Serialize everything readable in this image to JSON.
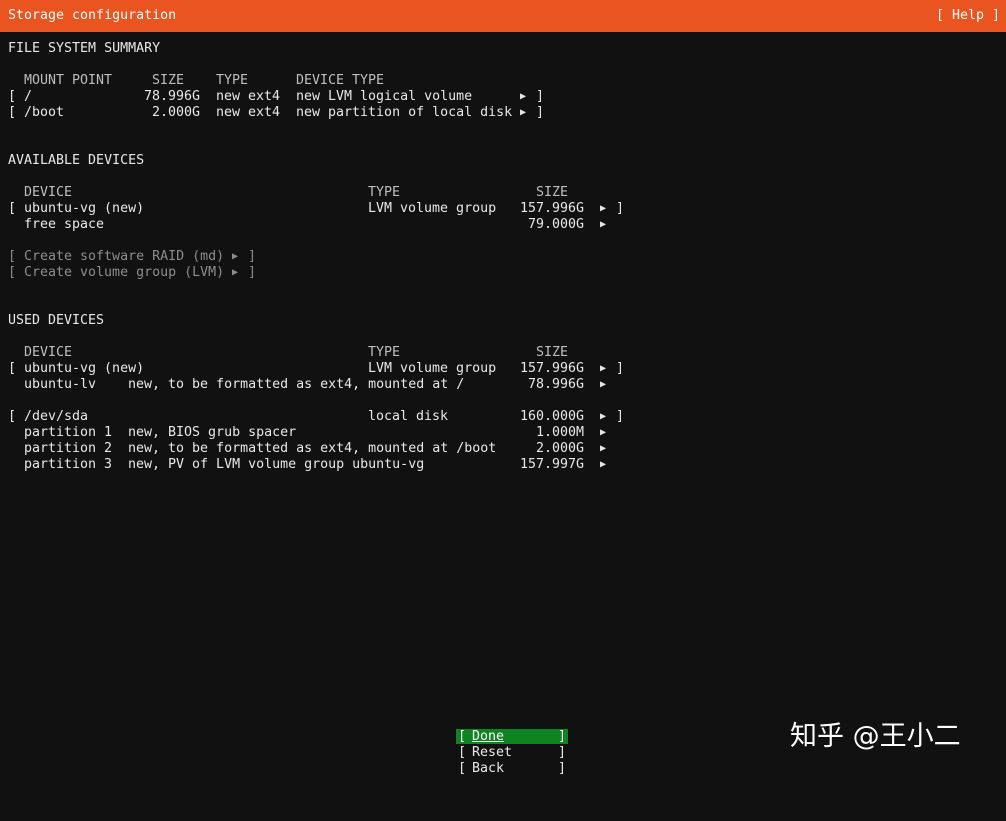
{
  "header": {
    "title": "Storage configuration",
    "help": "[ Help ]"
  },
  "fs_summary": {
    "title": "FILE SYSTEM SUMMARY",
    "columns": [
      "MOUNT POINT",
      "SIZE",
      "TYPE",
      "DEVICE TYPE"
    ],
    "rows": [
      {
        "mount": "/",
        "size": "78.996G",
        "type": "new ext4",
        "device_type": "new LVM logical volume"
      },
      {
        "mount": "/boot",
        "size": "2.000G",
        "type": "new ext4",
        "device_type": "new partition of local disk"
      }
    ]
  },
  "available": {
    "title": "AVAILABLE DEVICES",
    "columns": [
      "DEVICE",
      "TYPE",
      "SIZE"
    ],
    "device": {
      "name": "ubuntu-vg (new)",
      "type": "LVM volume group",
      "size": "157.996G"
    },
    "free": {
      "name": "free space",
      "size": "79.000G"
    },
    "actions": [
      "Create software RAID (md)",
      "Create volume group (LVM)"
    ]
  },
  "used": {
    "title": "USED DEVICES",
    "columns": [
      "DEVICE",
      "TYPE",
      "SIZE"
    ],
    "vg": {
      "name": "ubuntu-vg (new)",
      "type": "LVM volume group",
      "size": "157.996G"
    },
    "lv": {
      "name": "ubuntu-lv",
      "desc": "new, to be formatted as ext4, mounted at /",
      "size": "78.996G"
    },
    "disk": {
      "name": "/dev/sda",
      "type": "local disk",
      "size": "160.000G"
    },
    "partitions": [
      {
        "name": "partition 1",
        "desc": "new, BIOS grub spacer",
        "size": "1.000M"
      },
      {
        "name": "partition 2",
        "desc": "new, to be formatted as ext4, mounted at /boot",
        "size": "2.000G"
      },
      {
        "name": "partition 3",
        "desc": "new, PV of LVM volume group ubuntu-vg",
        "size": "157.997G"
      }
    ]
  },
  "buttons": {
    "done": "Done",
    "reset": "Reset",
    "back": "Back"
  },
  "watermark": "知乎 @王小二",
  "glyphs": {
    "lbracket": "[",
    "rbracket": "]",
    "arrow": "▶"
  },
  "colors": {
    "header_bg": "#e95420",
    "selected_bg": "#0e8420",
    "background": "#111111"
  }
}
